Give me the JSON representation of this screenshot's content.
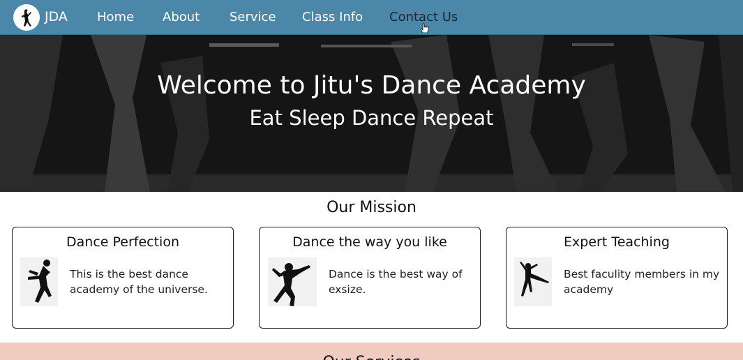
{
  "navbar": {
    "brand": "JDA",
    "logo_icon": "dancer-logo-icon",
    "links": [
      {
        "label": "Home"
      },
      {
        "label": "About"
      },
      {
        "label": "Service"
      },
      {
        "label": "Class Info"
      },
      {
        "label": "Contact Us"
      }
    ],
    "color": "#4a87a8"
  },
  "hero": {
    "title": "Welcome to Jitu's Dance Academy",
    "subtitle": "Eat Sleep Dance Repeat"
  },
  "mission": {
    "heading": "Our Mission",
    "cards": [
      {
        "title": "Dance Perfection",
        "text": "This is the best dance academy of the universe.",
        "icon": "breakdancer-silhouette-icon"
      },
      {
        "title": "Dance the way you like",
        "text": "Dance is the best way of exsize.",
        "icon": "hiphop-dancer-silhouette-icon"
      },
      {
        "title": "Expert Teaching",
        "text": "Best faculity members in my academy",
        "icon": "ballet-dancer-silhouette-icon"
      }
    ]
  },
  "next_section": {
    "heading": "Our Services",
    "color": "#f0cbbf"
  }
}
